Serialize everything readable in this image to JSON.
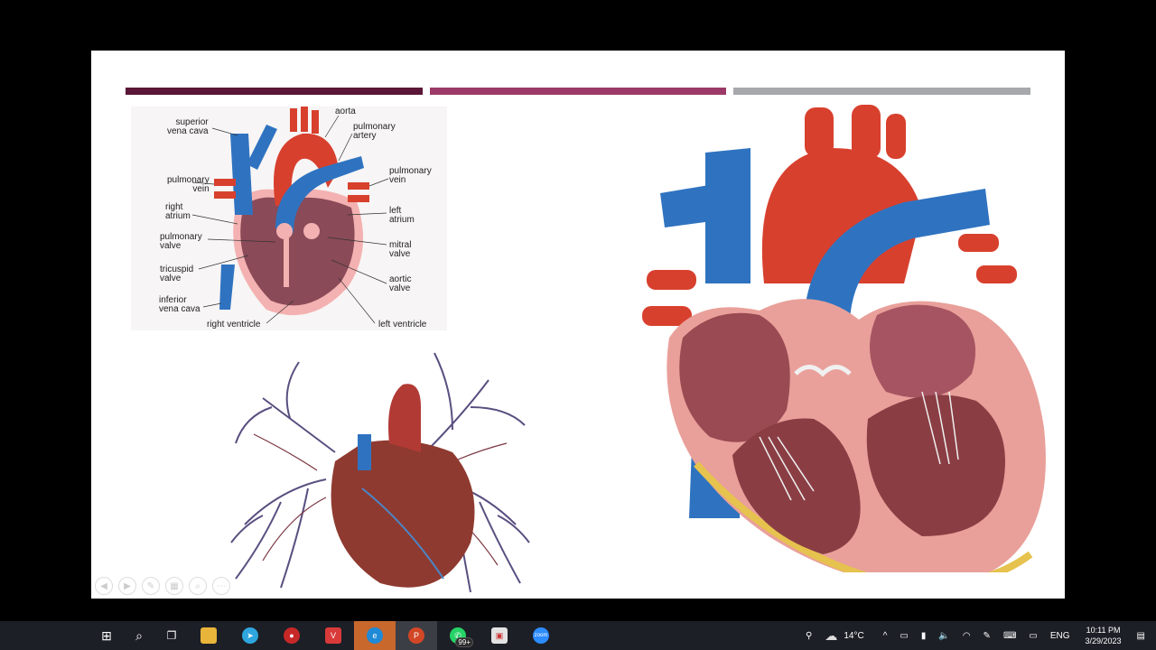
{
  "diagram_labels": {
    "superior_vena_cava": "superior\nvena cava",
    "aorta": "aorta",
    "pulmonary_artery": "pulmonary\nartery",
    "pulmonary_vein_left": "pulmonary\nvein",
    "pulmonary_vein_right": "pulmonary\nvein",
    "right_atrium": "right\natrium",
    "left_atrium": "left\natrium",
    "pulmonary_valve": "pulmonary\nvalve",
    "mitral_valve": "mitral\nvalve",
    "tricuspid_valve": "tricuspid\nvalve",
    "aortic_valve": "aortic\nvalve",
    "inferior_vena_cava": "inferior\nvena cava",
    "right_ventricle": "right ventricle",
    "left_ventricle": "left ventricle"
  },
  "colors": {
    "bar1": "#5a1737",
    "bar2": "#9b3a68",
    "bar3": "#a6a8ab",
    "artery": "#d8402e",
    "vein": "#2f73c0"
  },
  "taskbar": {
    "whatsapp_badge": "99+",
    "weather": "14°C",
    "language": "ENG",
    "time": "10:11 PM",
    "date": "3/29/2023",
    "zoom_label": "zoom"
  }
}
